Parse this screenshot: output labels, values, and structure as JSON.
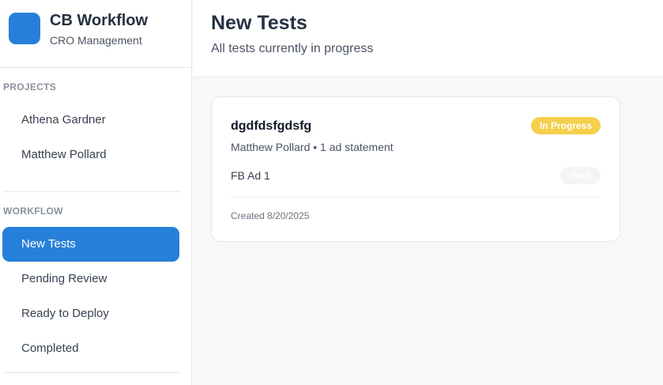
{
  "brand": {
    "title": "CB Workflow",
    "subtitle": "CRO Management",
    "logo_color": "#2680d9"
  },
  "sidebar": {
    "projects_label": "PROJECTS",
    "projects": [
      {
        "label": "Athena Gardner"
      },
      {
        "label": "Matthew Pollard"
      }
    ],
    "workflow_label": "WORKFLOW",
    "workflow": [
      {
        "label": "New Tests",
        "active": true
      },
      {
        "label": "Pending Review",
        "active": false
      },
      {
        "label": "Ready to Deploy",
        "active": false
      },
      {
        "label": "Completed",
        "active": false
      }
    ]
  },
  "header": {
    "title": "New Tests",
    "subtitle": "All tests currently in progress"
  },
  "tests": [
    {
      "name": "dgdfdsfgdsfg",
      "status": "In Progress",
      "status_color": "#f6cf4d",
      "meta": "Matthew Pollard • 1 ad statement",
      "ad_name": "FB Ad 1",
      "ad_status": "draft",
      "created": "Created 8/20/2025"
    }
  ],
  "colors": {
    "accent": "#2680d9",
    "background": "#f7f8fa"
  }
}
